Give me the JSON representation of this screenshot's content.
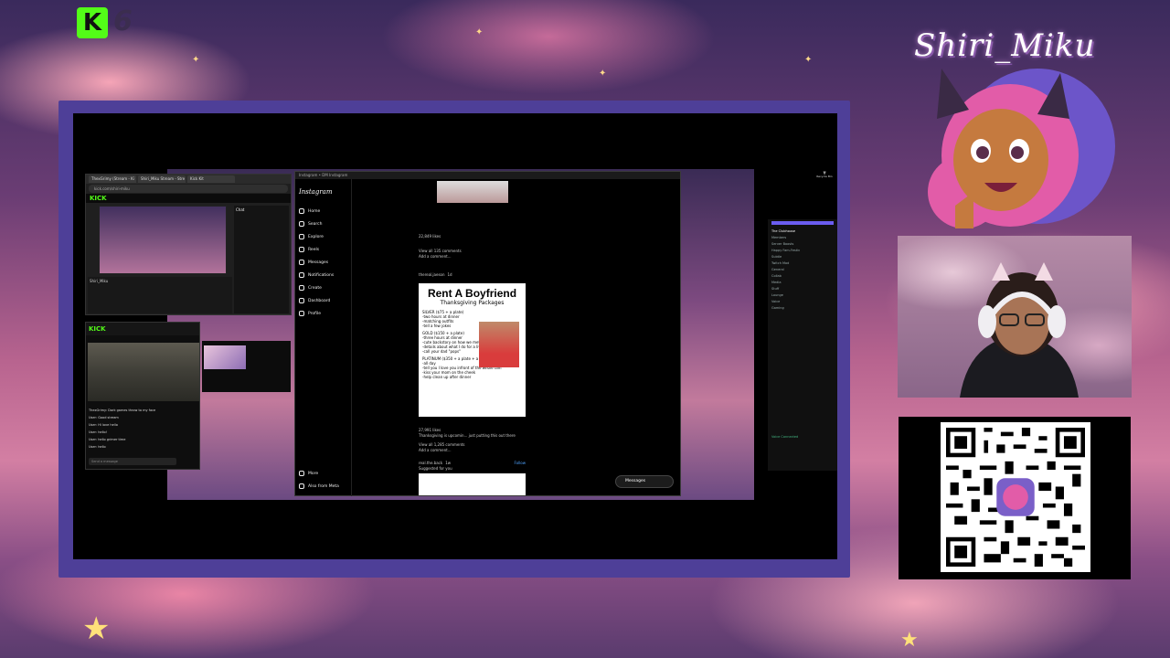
{
  "overlay": {
    "logo_k": "K",
    "logo_number": "6",
    "channel_name": "Shiri_Miku",
    "colors": {
      "kick_green": "#53fc18",
      "frame_purple": "#4e3f98",
      "discord_accent": "#6b5df0"
    }
  },
  "browser_window": {
    "tabs": [
      "ThexGrimy (Stream - Ki",
      "Shiri_Miku Stream - Stre",
      "Kick Kit"
    ],
    "url": "kick.com/shiri-miku",
    "kick_logo": "KICK",
    "streamer_name": "Shiri_Miku",
    "chat_header": "Chat"
  },
  "kick_window": {
    "kick_logo": "KICK",
    "chat_lines": [
      "ThexGrimy: Dark games throw to my face",
      "User: Good stream",
      "User: Hi love hello",
      "User: hello!",
      "User: hello grimer time",
      "User: hello"
    ],
    "chat_placeholder": "Send a message"
  },
  "instagram": {
    "title_bar": "Instagram • DM Instagram",
    "brand": "Instagram",
    "nav": [
      {
        "label": "Home",
        "icon": "home-icon"
      },
      {
        "label": "Search",
        "icon": "search-icon"
      },
      {
        "label": "Explore",
        "icon": "compass-icon"
      },
      {
        "label": "Reels",
        "icon": "reels-icon"
      },
      {
        "label": "Messages",
        "icon": "message-icon"
      },
      {
        "label": "Notifications",
        "icon": "heart-icon"
      },
      {
        "label": "Create",
        "icon": "plus-icon"
      },
      {
        "label": "Dashboard",
        "icon": "dashboard-icon"
      },
      {
        "label": "Profile",
        "icon": "profile-icon"
      }
    ],
    "more": "More",
    "also_from_meta": "Also from Meta",
    "post1": {
      "likes": "22,849 likes",
      "view_comments": "View all 135 comments",
      "add_comment": "Add a comment..."
    },
    "post2": {
      "author": "thereal.jaeson",
      "time": "1d",
      "likes": "27,991 likes",
      "caption": "Thanksgiving is upcomin... just putting this out there",
      "view_comments": "View all 1,285 comments",
      "add_comment": "Add a comment..."
    },
    "flyer": {
      "title": "Rent A Boyfriend",
      "subtitle": "Thanksgiving Packages",
      "silver": [
        "SILVER ($75 + a plate)",
        "-two hours at dinner",
        "-matching outfits",
        "-tell a few jokes"
      ],
      "gold": [
        "GOLD ($150 + a plate)",
        "-three hours at dinner",
        "-cute backstory on how we met",
        "-details about what I do for a living",
        "-call your dad \"pops\""
      ],
      "platinum": [
        "PLATINUM ($350 + a plate + a to-go plate)",
        "-all day",
        "-tell you I love you infront of the whole fam",
        "-kiss your mom on the cheek",
        "-help clean up after dinner"
      ]
    },
    "post3": {
      "author": "real.the.back",
      "time": "1w",
      "suggested": "Suggested for you",
      "follow": "Follow"
    },
    "messages_pill": "Messages"
  },
  "discord": {
    "server": "The Clubhouse",
    "items": [
      "Members",
      "Server Boosts",
      "Happy Fam-Festiv",
      "Subtle",
      "Twitch Mod",
      "General",
      "Collab",
      "Media",
      "Stuff",
      "Lounge",
      "Voice",
      "Gaming"
    ],
    "voice_connected": "Voice Connected"
  },
  "desktop": {
    "recycle_bin": "Recycle Bin"
  }
}
